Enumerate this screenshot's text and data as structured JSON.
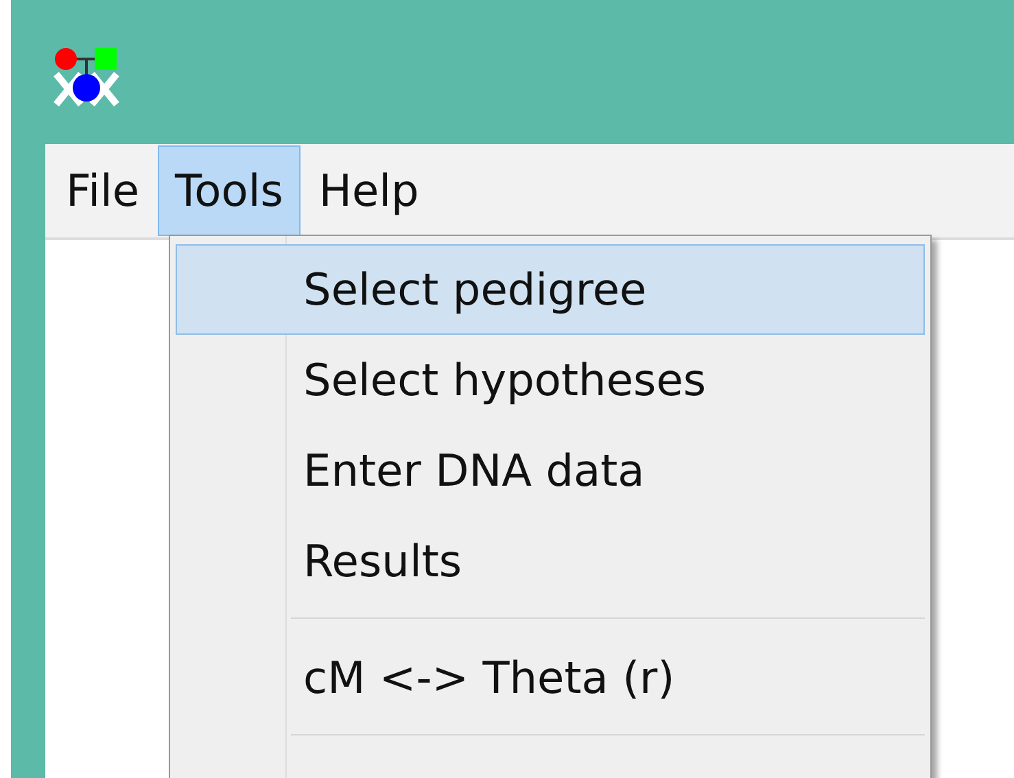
{
  "menu_bar": [
    {
      "label": "File",
      "selected": false
    },
    {
      "label": "Tools",
      "selected": true
    },
    {
      "label": "Help",
      "selected": false
    }
  ],
  "dropdown": [
    {
      "kind": "item",
      "label": "Select pedigree",
      "selected": true
    },
    {
      "kind": "item",
      "label": "Select hypotheses",
      "selected": false
    },
    {
      "kind": "item",
      "label": "Enter DNA data",
      "selected": false
    },
    {
      "kind": "item",
      "label": "Results",
      "selected": false
    },
    {
      "kind": "separator"
    },
    {
      "kind": "item",
      "label": "cM <-> Theta (r)",
      "selected": false
    },
    {
      "kind": "separator"
    }
  ]
}
